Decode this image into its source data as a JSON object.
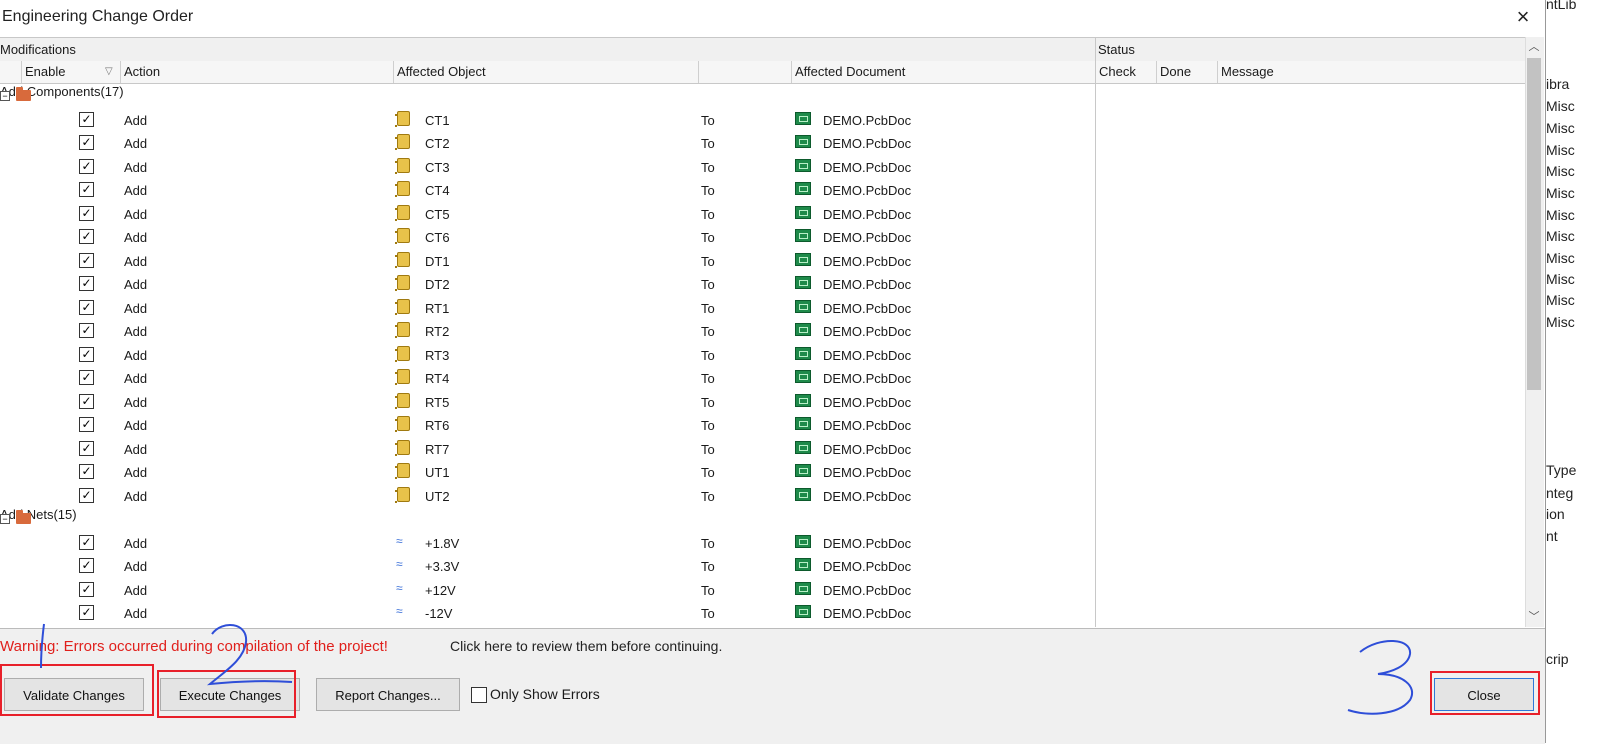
{
  "window": {
    "title": "Engineering Change Order"
  },
  "headers": {
    "modifications": "Modifications",
    "status": "Status",
    "enable": "Enable",
    "action": "Action",
    "affected_object": "Affected Object",
    "affected_document": "Affected Document",
    "check": "Check",
    "done": "Done",
    "message": "Message"
  },
  "groups": [
    {
      "label": "Add Components(17)",
      "items": [
        {
          "action": "Add",
          "object": "CT1",
          "to": "To",
          "document": "DEMO.PcbDoc"
        },
        {
          "action": "Add",
          "object": "CT2",
          "to": "To",
          "document": "DEMO.PcbDoc"
        },
        {
          "action": "Add",
          "object": "CT3",
          "to": "To",
          "document": "DEMO.PcbDoc"
        },
        {
          "action": "Add",
          "object": "CT4",
          "to": "To",
          "document": "DEMO.PcbDoc"
        },
        {
          "action": "Add",
          "object": "CT5",
          "to": "To",
          "document": "DEMO.PcbDoc"
        },
        {
          "action": "Add",
          "object": "CT6",
          "to": "To",
          "document": "DEMO.PcbDoc"
        },
        {
          "action": "Add",
          "object": "DT1",
          "to": "To",
          "document": "DEMO.PcbDoc"
        },
        {
          "action": "Add",
          "object": "DT2",
          "to": "To",
          "document": "DEMO.PcbDoc"
        },
        {
          "action": "Add",
          "object": "RT1",
          "to": "To",
          "document": "DEMO.PcbDoc"
        },
        {
          "action": "Add",
          "object": "RT2",
          "to": "To",
          "document": "DEMO.PcbDoc"
        },
        {
          "action": "Add",
          "object": "RT3",
          "to": "To",
          "document": "DEMO.PcbDoc"
        },
        {
          "action": "Add",
          "object": "RT4",
          "to": "To",
          "document": "DEMO.PcbDoc"
        },
        {
          "action": "Add",
          "object": "RT5",
          "to": "To",
          "document": "DEMO.PcbDoc"
        },
        {
          "action": "Add",
          "object": "RT6",
          "to": "To",
          "document": "DEMO.PcbDoc"
        },
        {
          "action": "Add",
          "object": "RT7",
          "to": "To",
          "document": "DEMO.PcbDoc"
        },
        {
          "action": "Add",
          "object": "UT1",
          "to": "To",
          "document": "DEMO.PcbDoc"
        },
        {
          "action": "Add",
          "object": "UT2",
          "to": "To",
          "document": "DEMO.PcbDoc"
        }
      ]
    },
    {
      "label": "Add Nets(15)",
      "items": [
        {
          "action": "Add",
          "object": "+1.8V",
          "to": "To",
          "document": "DEMO.PcbDoc"
        },
        {
          "action": "Add",
          "object": "+3.3V",
          "to": "To",
          "document": "DEMO.PcbDoc"
        },
        {
          "action": "Add",
          "object": "+12V",
          "to": "To",
          "document": "DEMO.PcbDoc"
        },
        {
          "action": "Add",
          "object": "-12V",
          "to": "To",
          "document": "DEMO.PcbDoc"
        }
      ]
    }
  ],
  "footer": {
    "warning": "Warning: Errors occurred during compilation of the project!",
    "review": "Click here to review them before continuing.",
    "validate": "Validate Changes",
    "execute": "Execute Changes",
    "report": "Report Changes...",
    "only_show_errors": "Only Show Errors",
    "close": "Close"
  },
  "background_panel": {
    "lines": [
      "ntLib",
      "ibra",
      "Misc",
      "Misc",
      "Misc",
      "Misc",
      "Misc",
      "Misc",
      "Misc",
      "Misc",
      "Misc",
      "Misc",
      "Misc",
      "Type",
      "nteg",
      "ion",
      "nt",
      "crip"
    ]
  },
  "colors": {
    "group_row": "#838383",
    "warning": "#e0201c",
    "annotation_red": "#e8202a",
    "annotation_blue": "#2e4ed8"
  }
}
